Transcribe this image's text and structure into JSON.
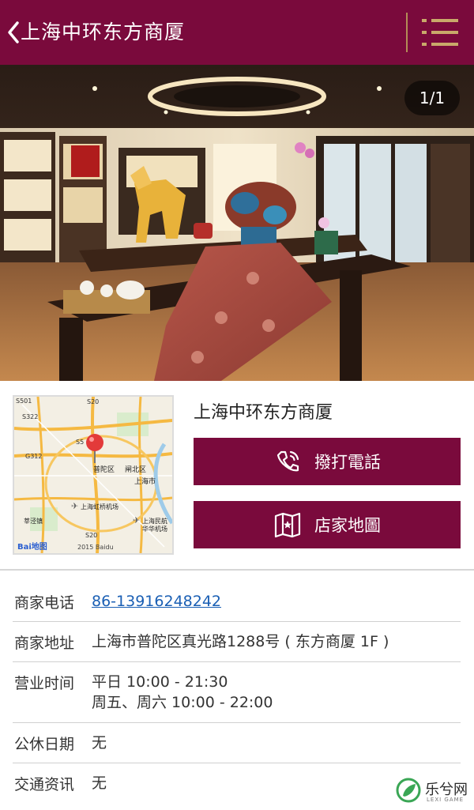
{
  "header": {
    "title": "上海中环东方商厦"
  },
  "hero": {
    "counter": "1/1"
  },
  "store": {
    "name": "上海中环东方商厦",
    "call_label": "撥打電話",
    "map_label": "店家地圖"
  },
  "map": {
    "labels": {
      "s501": "S501",
      "s322": "S322",
      "s20_top": "S20",
      "s5": "S5",
      "g312": "G312",
      "putuo": "普陀区",
      "zhabei": "闸北区",
      "shanghai": "上海市",
      "hongqiao": "上海虹桥机场",
      "xinjing": "莘泾镇",
      "minzhang": "上海民航",
      "huahua": "华华机场",
      "s20_bottom": "S20",
      "copyright": "2015 Baidu",
      "baidu": "Bai地图"
    }
  },
  "details": {
    "phone_label": "商家电话",
    "phone_value": "86-13916248242",
    "address_label": "商家地址",
    "address_value": "上海市普陀区真光路1288号 ( 东方商厦 1F )",
    "hours_label": "营业时间",
    "hours_line1": "平日 10:00 - 21:30",
    "hours_line2": "周五、周六 10:00 - 22:00",
    "holiday_label": "公休日期",
    "holiday_value": "无",
    "traffic_label": "交通资讯",
    "traffic_value": "无"
  },
  "watermark": {
    "text": "乐兮网",
    "sub": "LEXI GAME"
  },
  "colors": {
    "brand": "#7a0a3c",
    "accent_gold": "#c9a96a",
    "link": "#1a5fb4"
  }
}
